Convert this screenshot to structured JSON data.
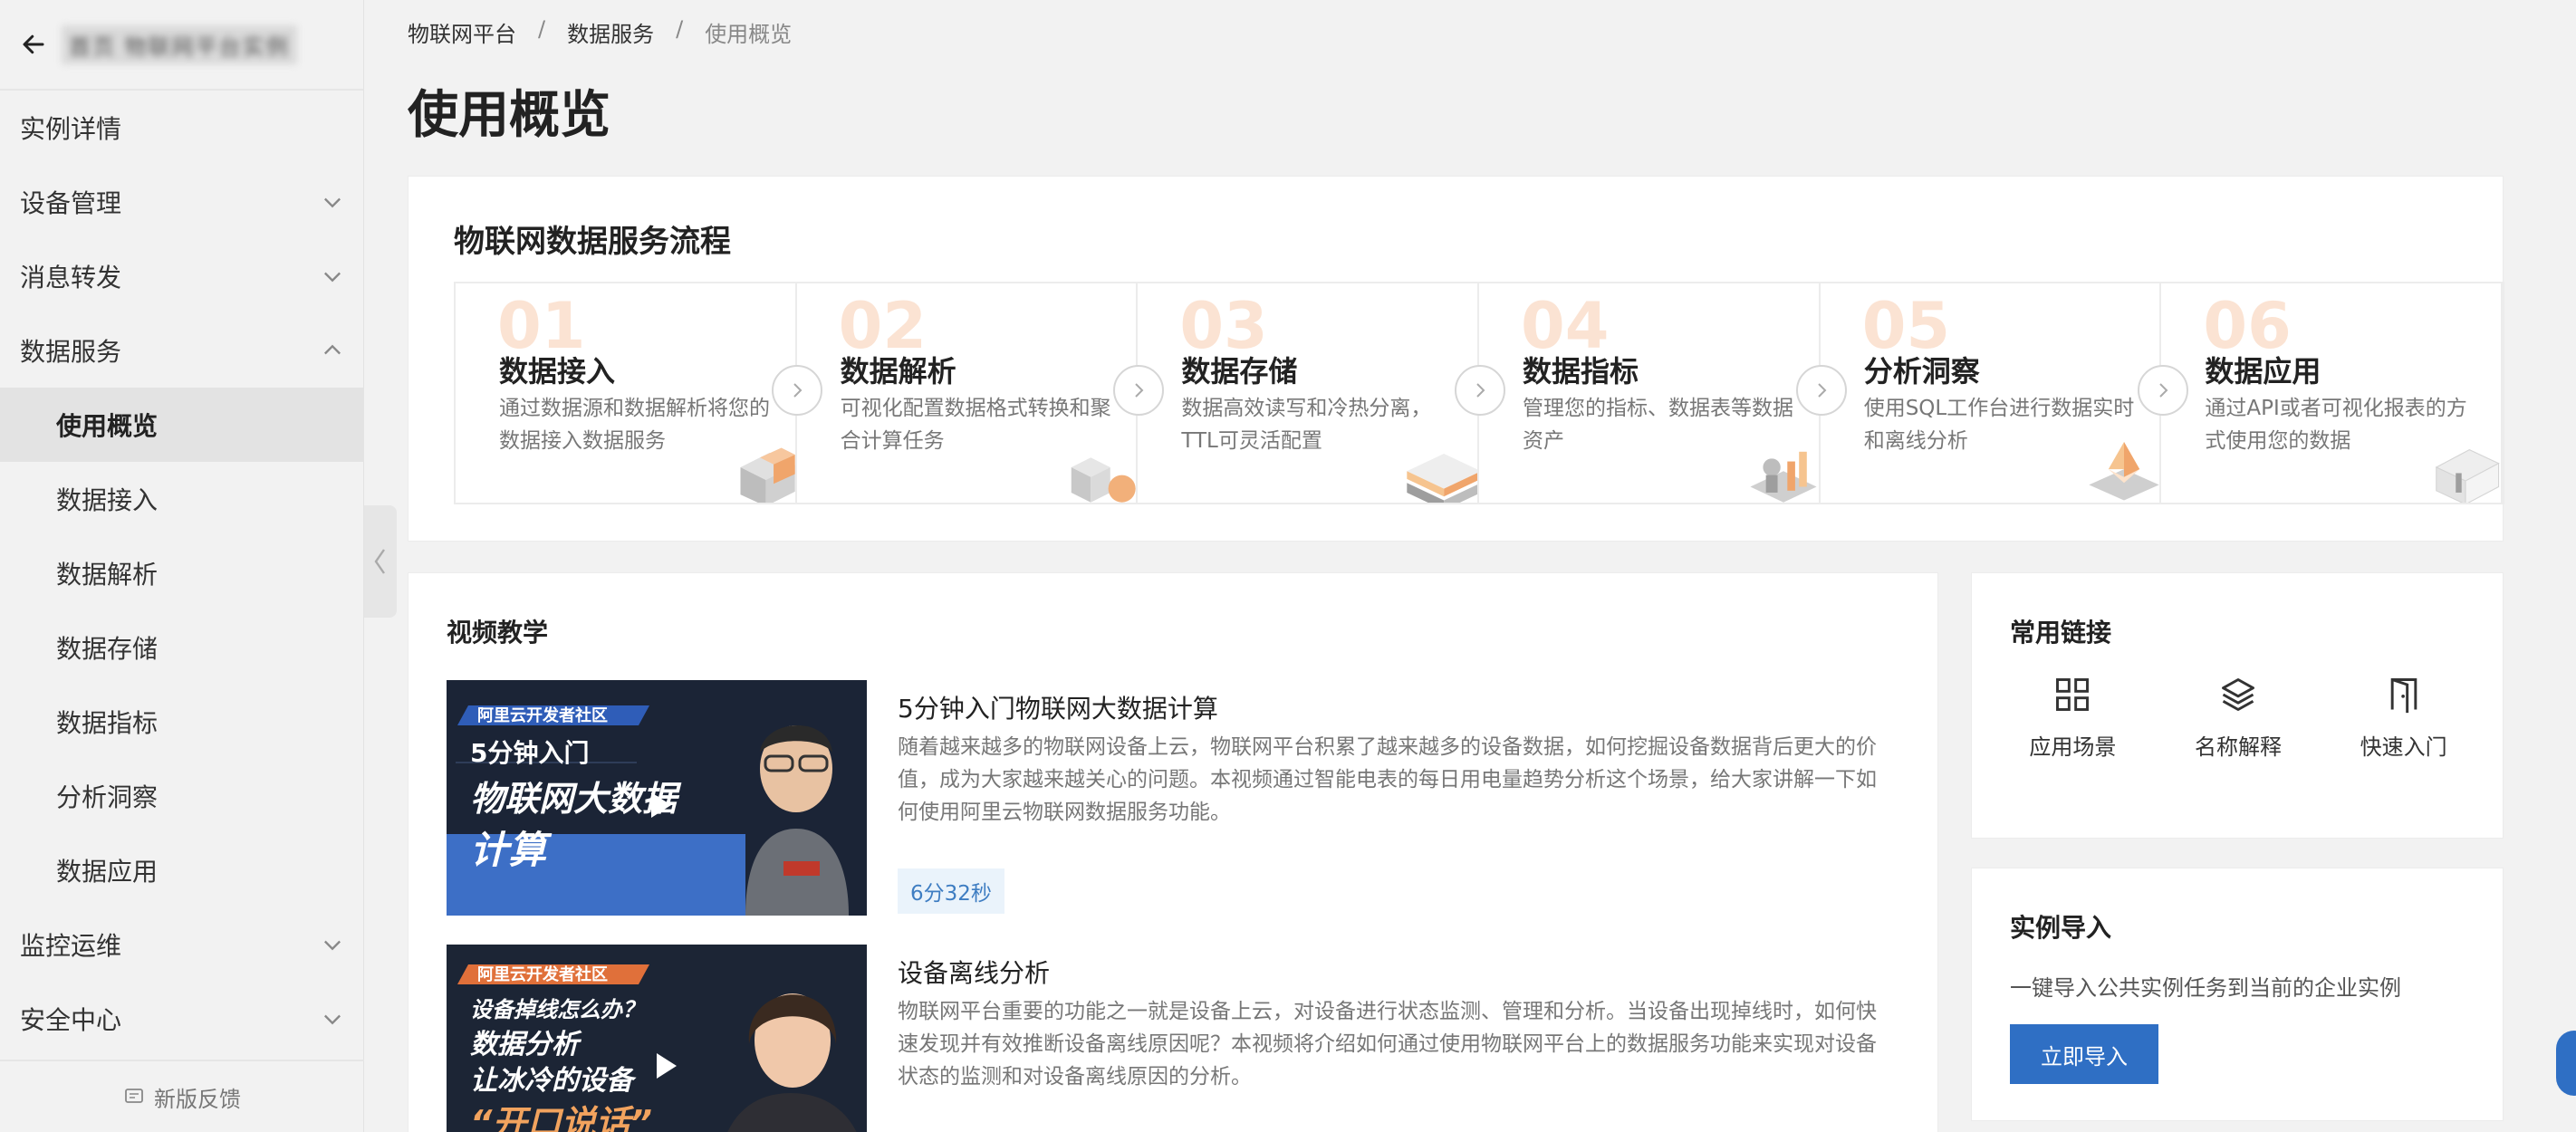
{
  "sidebar": {
    "title": "首页 物联网平台实例",
    "items": [
      {
        "label": "实例详情",
        "chevron": "none"
      },
      {
        "label": "设备管理",
        "chevron": "down"
      },
      {
        "label": "消息转发",
        "chevron": "down"
      },
      {
        "label": "数据服务",
        "chevron": "up"
      },
      {
        "label": "使用概览",
        "chevron": "none",
        "sub": true,
        "active": true
      },
      {
        "label": "数据接入",
        "chevron": "none",
        "sub": true
      },
      {
        "label": "数据解析",
        "chevron": "none",
        "sub": true
      },
      {
        "label": "数据存储",
        "chevron": "none",
        "sub": true
      },
      {
        "label": "数据指标",
        "chevron": "none",
        "sub": true
      },
      {
        "label": "分析洞察",
        "chevron": "none",
        "sub": true
      },
      {
        "label": "数据应用",
        "chevron": "none",
        "sub": true
      },
      {
        "label": "监控运维",
        "chevron": "down"
      },
      {
        "label": "安全中心",
        "chevron": "down"
      }
    ],
    "feedback": "新版反馈"
  },
  "breadcrumb": {
    "items": [
      "物联网平台",
      "数据服务",
      "使用概览"
    ],
    "separator": "/"
  },
  "page_title": "使用概览",
  "flow": {
    "title": "物联网数据服务流程",
    "steps": [
      {
        "num": "01",
        "name": "数据接入",
        "desc": "通过数据源和数据解析将您的数据接入数据服务"
      },
      {
        "num": "02",
        "name": "数据解析",
        "desc": "可视化配置数据格式转换和聚合计算任务"
      },
      {
        "num": "03",
        "name": "数据存储",
        "desc": "数据高效读写和冷热分离，TTL可灵活配置"
      },
      {
        "num": "04",
        "name": "数据指标",
        "desc": "管理您的指标、数据表等数据资产"
      },
      {
        "num": "05",
        "name": "分析洞察",
        "desc": "使用SQL工作台进行数据实时和离线分析"
      },
      {
        "num": "06",
        "name": "数据应用",
        "desc": "通过API或者可视化报表的方式使用您的数据"
      }
    ]
  },
  "video": {
    "title": "视频教学",
    "items": [
      {
        "title": "5分钟入门物联网大数据计算",
        "desc": "随着越来越多的物联网设备上云，物联网平台积累了越来越多的设备数据，如何挖掘设备数据背后更大的价值，成为大家越来越关心的问题。本视频通过智能电表的每日用电量趋势分析这个场景，给大家讲解一下如何使用阿里云物联网数据服务功能。",
        "duration": "6分32秒",
        "thumb": {
          "badge": "阿里云开发者社区",
          "line1": "5分钟入门",
          "line2": "物联网大数据",
          "line3": "计算"
        }
      },
      {
        "title": "设备离线分析",
        "desc": "物联网平台重要的功能之一就是设备上云，对设备进行状态监测、管理和分析。当设备出现掉线时，如何快速发现并有效推断设备离线原因呢？本视频将介绍如何通过使用物联网平台上的数据服务功能来实现对设备状态的监测和对设备离线原因的分析。",
        "thumb": {
          "badge": "阿里云开发者社区",
          "line1": "设备掉线怎么办？",
          "line2": "数据分析",
          "line3": "让冰冷的设备",
          "line4": "“开口说话”"
        }
      }
    ]
  },
  "links": {
    "title": "常用链接",
    "items": [
      {
        "label": "应用场景",
        "icon": "grid-icon"
      },
      {
        "label": "名称解释",
        "icon": "layers-icon"
      },
      {
        "label": "快速入门",
        "icon": "door-icon"
      }
    ]
  },
  "import": {
    "title": "实例导入",
    "desc": "一键导入公共实例任务到当前的企业实例",
    "button": "立即导入"
  },
  "colors": {
    "accent": "#2f6fc4",
    "step_number": "#fbe3d3",
    "duration_bg": "#eaf3fb",
    "duration_text": "#3e7dc2"
  }
}
